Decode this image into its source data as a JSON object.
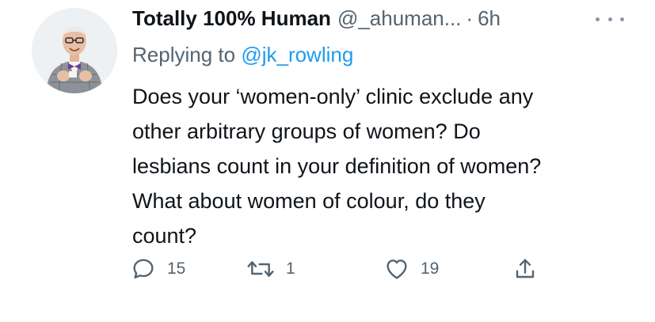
{
  "tweet": {
    "display_name": "Totally 100% Human",
    "handle": "@_ahuman...",
    "separator": "·",
    "time": "6h",
    "reply_prefix": "Replying to ",
    "reply_to": "@jk_rowling",
    "text_lines": [
      "Does your ‘women-only’ clinic exclude any",
      "other arbitrary groups of women? Do",
      "lesbians count in your definition of women?",
      "What about women of colour, do they",
      "count?"
    ]
  },
  "actions": {
    "replies": "15",
    "retweets": "1",
    "likes": "19"
  },
  "icons": {
    "more": "more-horizontal-icon",
    "reply": "reply-bubble-icon",
    "retweet": "retweet-icon",
    "like": "heart-icon",
    "share": "share-upload-icon"
  },
  "colors": {
    "text": "#0f1419",
    "muted": "#536471",
    "link": "#1d9bf0",
    "icon": "#536471"
  }
}
